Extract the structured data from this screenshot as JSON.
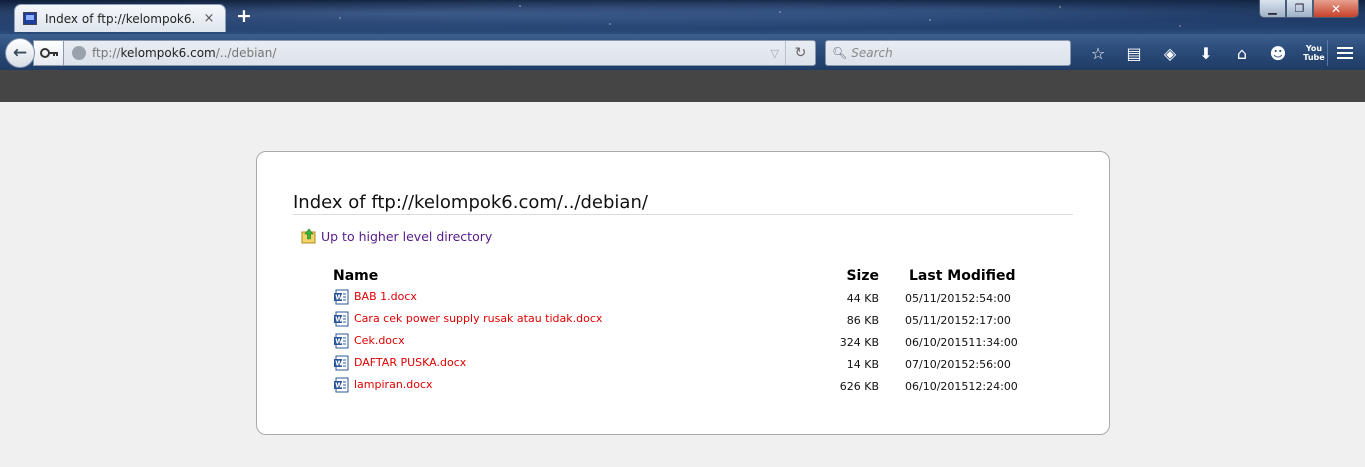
{
  "browser": {
    "tab": {
      "title": "Index of ftp://kelompok6.c...",
      "close": "×"
    },
    "new_tab": "+",
    "window_controls": {
      "minimize": "▁",
      "maximize": "❐",
      "close": "✕"
    },
    "nav": {
      "back": "←",
      "url_scheme": "ftp://",
      "url_host": "kelompok6.com",
      "url_path": "/../debian/",
      "search_placeholder": "Search",
      "reload": "↻"
    },
    "toolbar_icons": [
      "bookmark-star-icon",
      "reading-list-icon",
      "pocket-icon",
      "download-icon",
      "home-icon",
      "smiley-icon",
      "youtube-icon"
    ],
    "youtube_label": "You Tube"
  },
  "page": {
    "heading": "Index of ftp://kelompok6.com/../debian/",
    "up_link": "Up to higher level directory",
    "columns": {
      "name": "Name",
      "size": "Size",
      "modified": "Last Modified"
    },
    "files": [
      {
        "name": "BAB 1.docx",
        "size": "44 KB",
        "date": "05/11/2015",
        "time": "2:54:00"
      },
      {
        "name": "Cara cek power supply rusak atau tidak.docx",
        "size": "86 KB",
        "date": "05/11/2015",
        "time": "2:17:00"
      },
      {
        "name": "Cek.docx",
        "size": "324 KB",
        "date": "06/10/2015",
        "time": "11:34:00"
      },
      {
        "name": "DAFTAR PUSKA.docx",
        "size": "14 KB",
        "date": "07/10/2015",
        "time": "2:56:00"
      },
      {
        "name": "lampiran.docx",
        "size": "626 KB",
        "date": "06/10/2015",
        "time": "12:24:00"
      }
    ]
  },
  "colors": {
    "file_link": "#e00000",
    "up_link": "#551a8b",
    "strip": "#454545",
    "background": "#f0f0f0"
  }
}
